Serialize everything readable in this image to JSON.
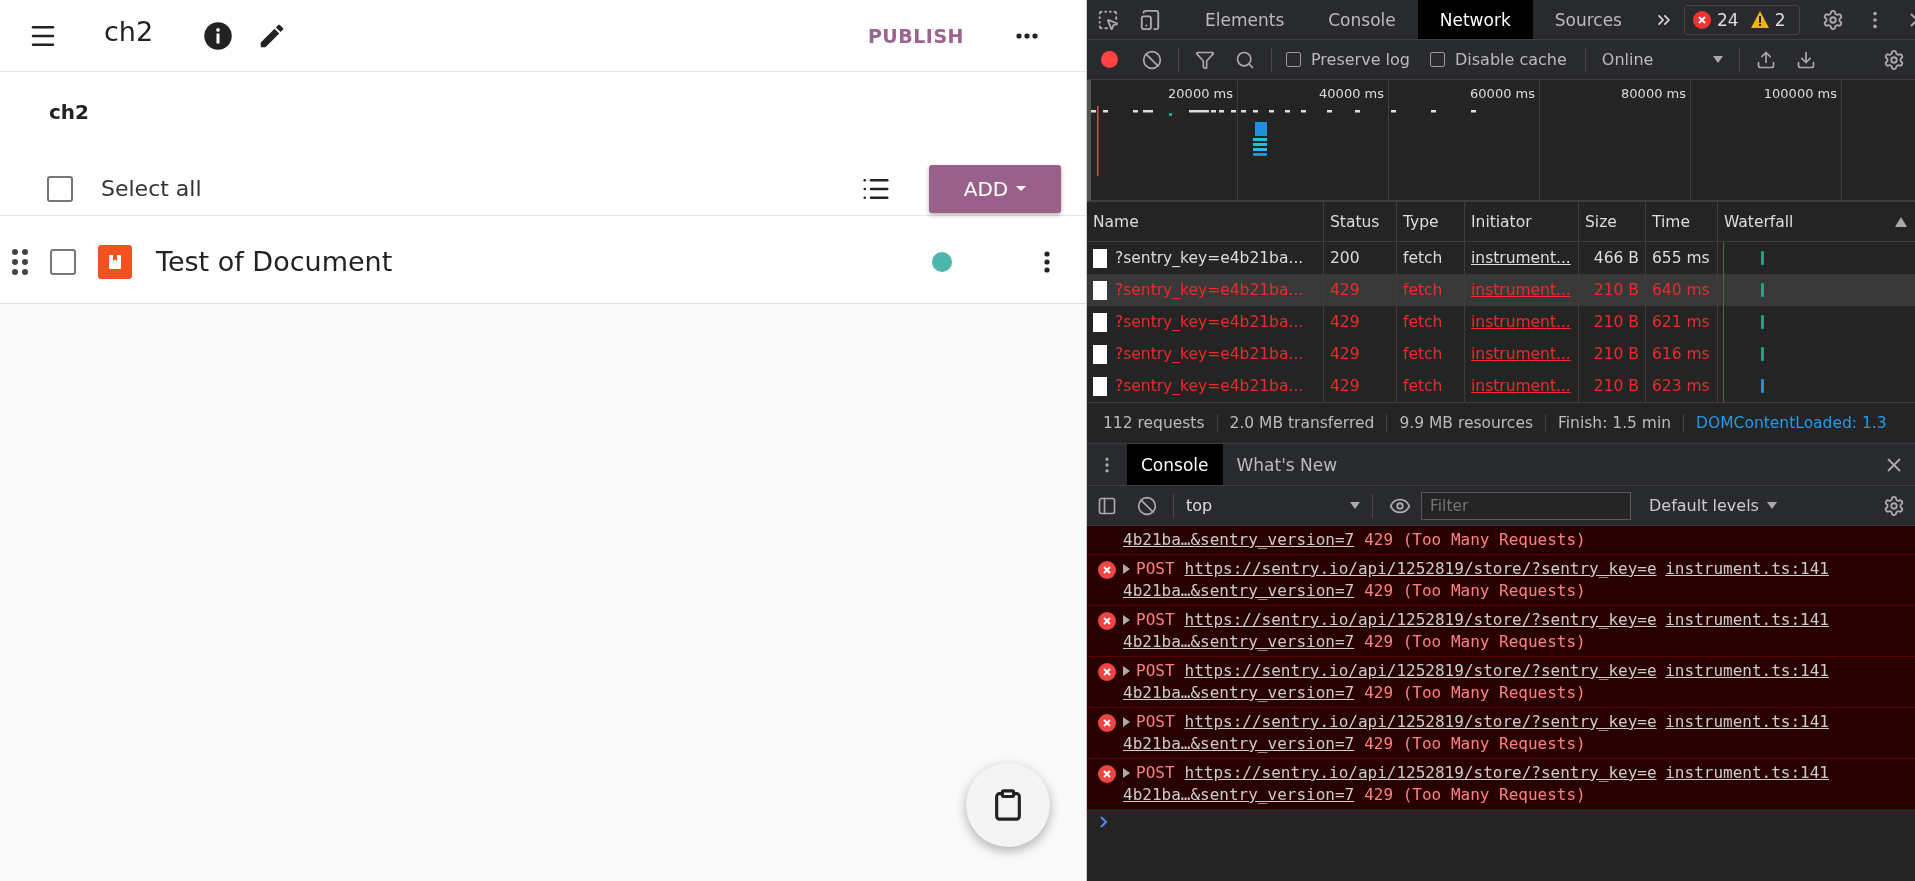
{
  "app": {
    "header": {
      "title": "ch2",
      "publish": "PUBLISH"
    },
    "channel_title": "ch2",
    "toolbar": {
      "select_all": {
        "label": "Select all",
        "checked": false
      },
      "add": "ADD"
    },
    "items": [
      {
        "title": "Test of Document",
        "checked": false,
        "color": "#4db6ac"
      }
    ]
  },
  "devtools": {
    "tabs": [
      {
        "label": "Elements",
        "selected": false
      },
      {
        "label": "Console",
        "selected": false
      },
      {
        "label": "Network",
        "selected": true
      },
      {
        "label": "Sources",
        "selected": false
      }
    ],
    "errors": "24",
    "warnings": "2",
    "network_toolbar": {
      "recording": true,
      "preserve_log": {
        "label": "Preserve log",
        "checked": false
      },
      "disable_cache": {
        "label": "Disable cache",
        "checked": false
      },
      "throttle": "Online"
    },
    "overview_ticks": [
      "20000 ms",
      "40000 ms",
      "60000 ms",
      "80000 ms",
      "100000 ms"
    ],
    "columns": [
      "Name",
      "Status",
      "Type",
      "Initiator",
      "Size",
      "Time",
      "Waterfall"
    ],
    "requests": [
      {
        "name": "?sentry_key=e4b21ba...",
        "status": "200",
        "type": "fetch",
        "initiator": "instrument...",
        "size": "466 B",
        "time": "655 ms",
        "error": false,
        "hovered": false,
        "color": "#1aa68a"
      },
      {
        "name": "?sentry_key=e4b21ba...",
        "status": "429",
        "type": "fetch",
        "initiator": "instrument...",
        "size": "210 B",
        "time": "640 ms",
        "error": true,
        "hovered": true,
        "color": "#1aa68a"
      },
      {
        "name": "?sentry_key=e4b21ba...",
        "status": "429",
        "type": "fetch",
        "initiator": "instrument...",
        "size": "210 B",
        "time": "621 ms",
        "error": true,
        "hovered": false,
        "color": "#1aa68a"
      },
      {
        "name": "?sentry_key=e4b21ba...",
        "status": "429",
        "type": "fetch",
        "initiator": "instrument...",
        "size": "210 B",
        "time": "616 ms",
        "error": true,
        "hovered": false,
        "color": "#1aa68a"
      },
      {
        "name": "?sentry_key=e4b21ba...",
        "status": "429",
        "type": "fetch",
        "initiator": "instrument...",
        "size": "210 B",
        "time": "623 ms",
        "error": true,
        "hovered": false,
        "color": "#1e90e0"
      }
    ],
    "summary": [
      "112 requests",
      "2.0 MB transferred",
      "9.9 MB resources",
      "Finish: 1.5 min"
    ],
    "dom_content_loaded": "DOMContentLoaded: 1.3",
    "drawer_tabs": [
      {
        "label": "Console",
        "selected": true
      },
      {
        "label": "What's New",
        "selected": false
      }
    ],
    "console_toolbar": {
      "context": "top",
      "filter_placeholder": "Filter",
      "levels": "Default levels"
    },
    "messages": [
      {
        "kind": "continuation",
        "url_tail": "4b21ba…&sentry_version=7",
        "status": "429 (Too Many Requests)"
      },
      {
        "kind": "error",
        "method": "POST",
        "url_head": "https://sentry.io/api/1252819/store/?sentry_key=e",
        "url_tail": "4b21ba…&sentry_version=7",
        "status": "429 (Too Many Requests)",
        "source": "instrument.ts:141"
      },
      {
        "kind": "error",
        "method": "POST",
        "url_head": "https://sentry.io/api/1252819/store/?sentry_key=e",
        "url_tail": "4b21ba…&sentry_version=7",
        "status": "429 (Too Many Requests)",
        "source": "instrument.ts:141"
      },
      {
        "kind": "error",
        "method": "POST",
        "url_head": "https://sentry.io/api/1252819/store/?sentry_key=e",
        "url_tail": "4b21ba…&sentry_version=7",
        "status": "429 (Too Many Requests)",
        "source": "instrument.ts:141"
      },
      {
        "kind": "error",
        "method": "POST",
        "url_head": "https://sentry.io/api/1252819/store/?sentry_key=e",
        "url_tail": "4b21ba…&sentry_version=7",
        "status": "429 (Too Many Requests)",
        "source": "instrument.ts:141"
      },
      {
        "kind": "error",
        "method": "POST",
        "url_head": "https://sentry.io/api/1252819/store/?sentry_key=e",
        "url_tail": "4b21ba…&sentry_version=7",
        "status": "429 (Too Many Requests)",
        "source": "instrument.ts:141"
      }
    ]
  }
}
